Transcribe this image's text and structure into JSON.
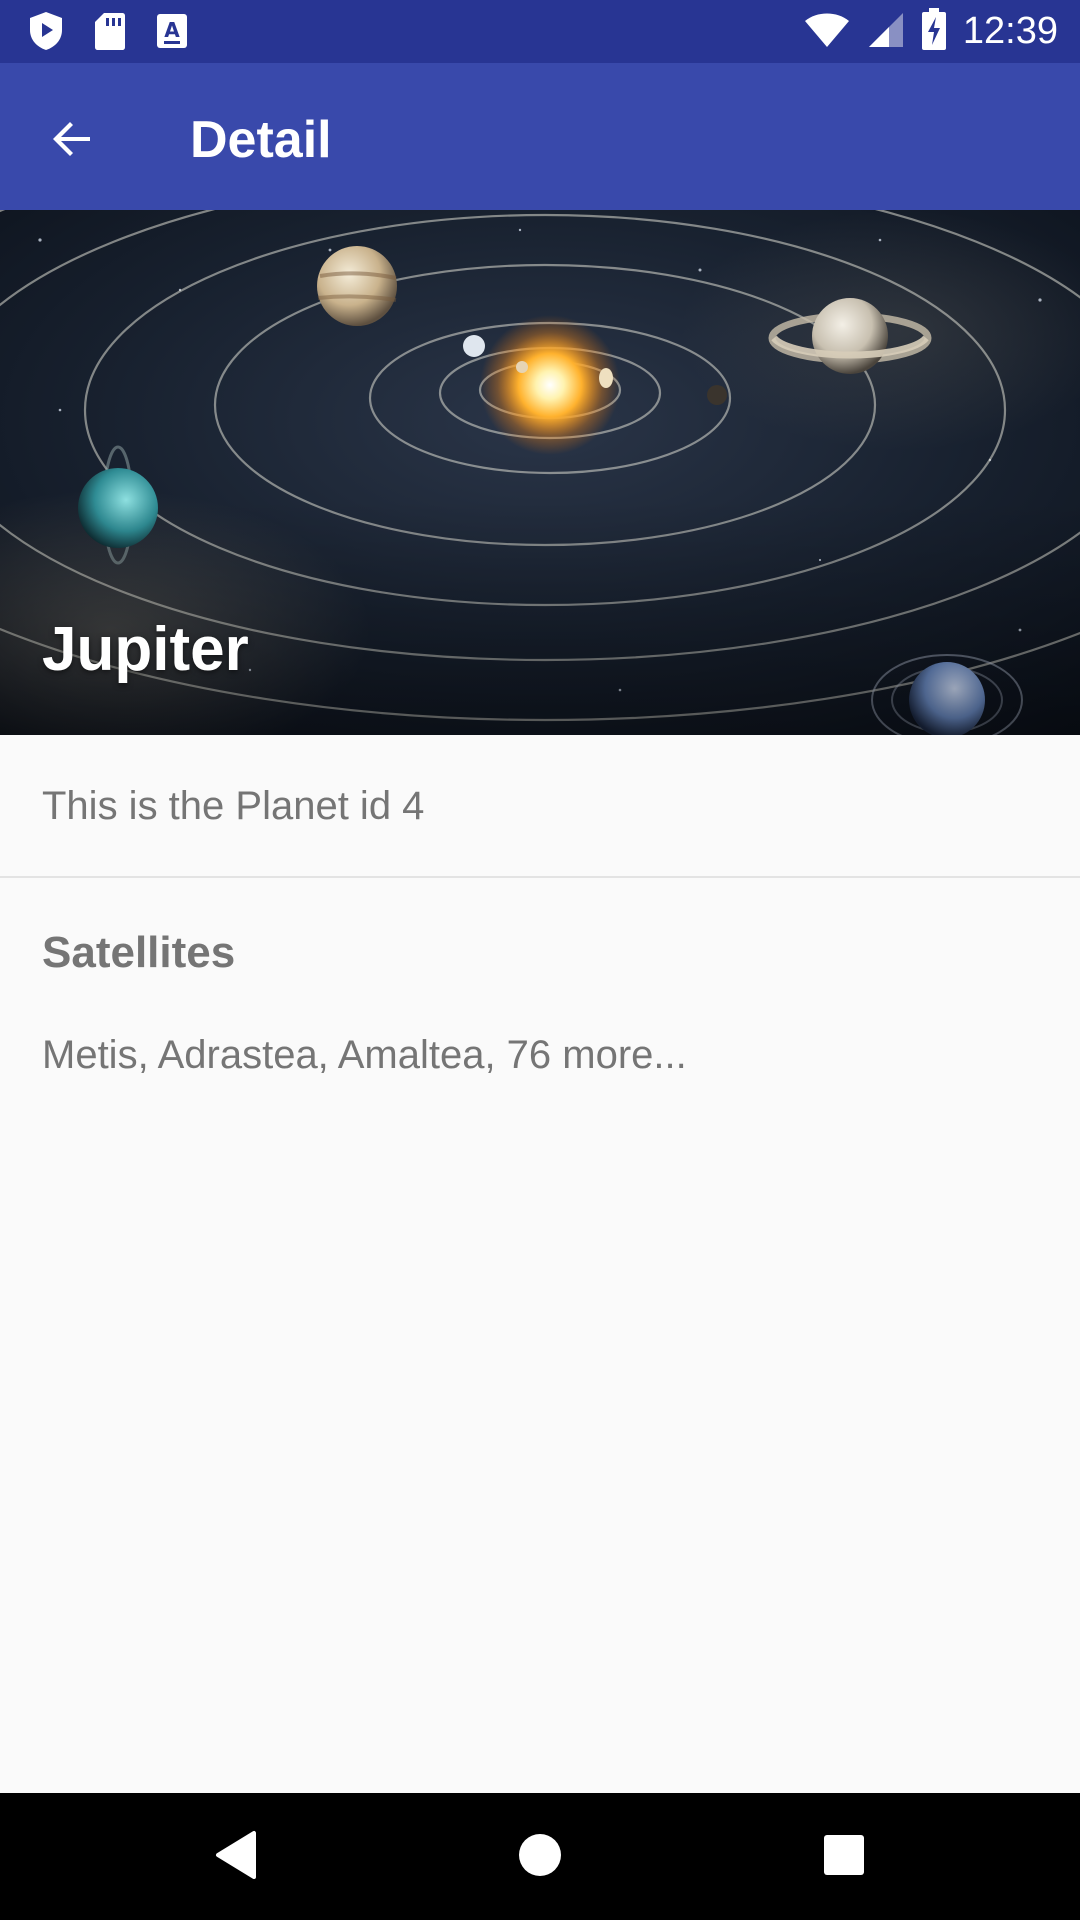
{
  "status_bar": {
    "time": "12:39",
    "icons": [
      "shield-play-icon",
      "sd-card-icon",
      "keyboard-a-icon",
      "wifi-icon",
      "cell-signal-icon",
      "battery-charging-icon"
    ]
  },
  "toolbar": {
    "title": "Detail",
    "back_icon": "arrow-back-icon",
    "background": "#3949ab"
  },
  "hero": {
    "title": "Jupiter",
    "image": "solar-system-illustration"
  },
  "detail": {
    "description": "This is the Planet id 4",
    "satellites_heading": "Satellites",
    "satellites_text": "Metis, Adrastea, Amaltea, 76 more..."
  },
  "nav_bar": {
    "buttons": [
      "back-triangle-icon",
      "home-circle-icon",
      "recents-square-icon"
    ]
  },
  "colors": {
    "status_bar": "#283593",
    "accent": "#3949ab",
    "text_secondary": "#757575"
  }
}
